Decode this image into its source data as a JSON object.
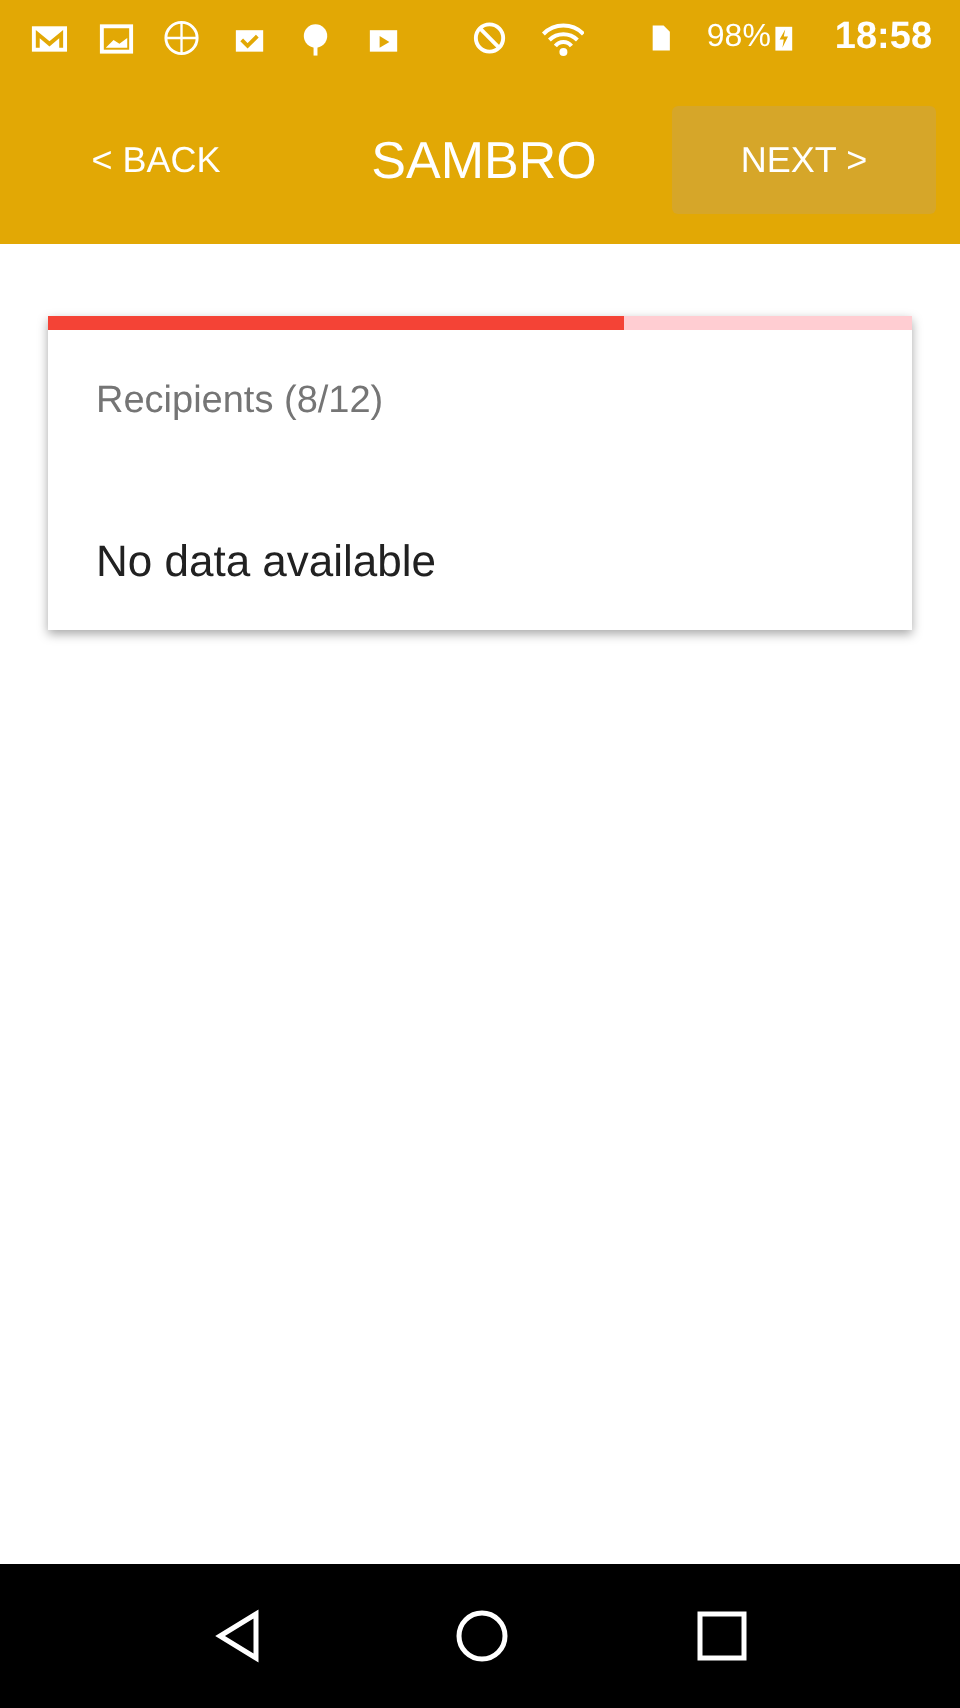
{
  "status_bar": {
    "battery": "98%",
    "time": "18:58"
  },
  "app_bar": {
    "back": "< BACK",
    "title": "SAMBRO",
    "next": "NEXT >"
  },
  "card": {
    "progress": {
      "level": 0.667
    },
    "heading": "Recipients (8/12)",
    "message": "No data available"
  }
}
